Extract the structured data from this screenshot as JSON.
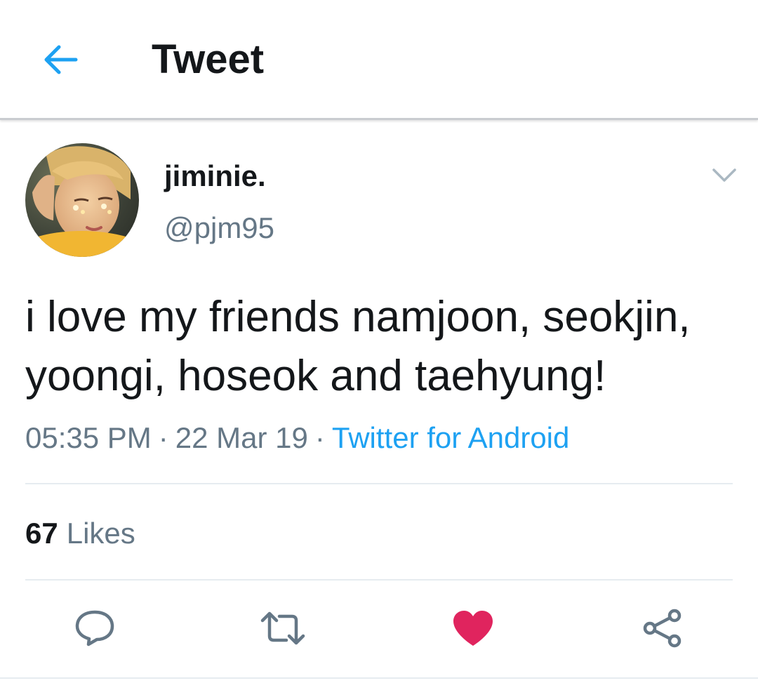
{
  "header": {
    "title": "Tweet",
    "back_icon": "arrow-left-icon"
  },
  "colors": {
    "accent": "#1da1f2",
    "text_primary": "#14171a",
    "text_secondary": "#657786",
    "like_active": "#e0245e",
    "divider": "#e6ecf0"
  },
  "tweet": {
    "author": {
      "display_name": "jiminie.",
      "handle": "@pjm95",
      "avatar_icon": "avatar-photo"
    },
    "text": "i love my friends namjoon, seokjin, yoongi, hoseok and taehyung!",
    "time": "05:35 PM",
    "separator": "·",
    "date": "22 Mar 19",
    "source": "Twitter for Android",
    "stats": {
      "likes_count": "67",
      "likes_label": "Likes"
    },
    "liked": true
  },
  "actions": [
    {
      "name": "reply",
      "icon": "reply-icon"
    },
    {
      "name": "retweet",
      "icon": "retweet-icon"
    },
    {
      "name": "like",
      "icon": "heart-icon"
    },
    {
      "name": "share",
      "icon": "share-icon"
    }
  ]
}
